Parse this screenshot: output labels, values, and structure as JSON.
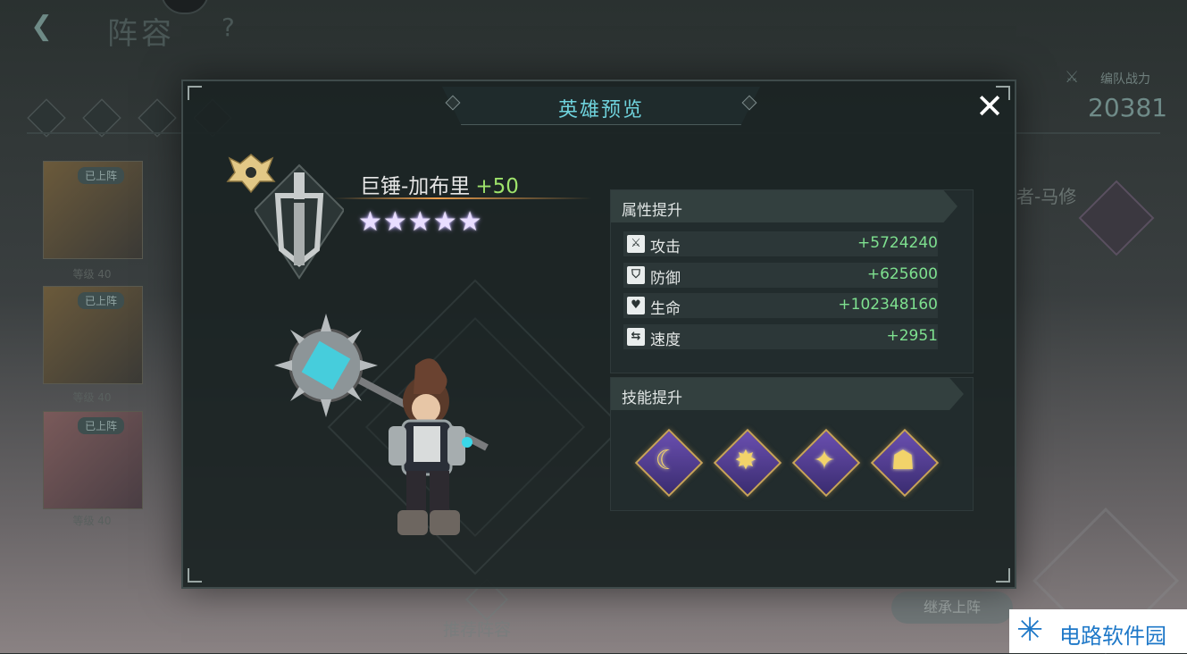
{
  "background": {
    "page_title": "阵容",
    "help": "?",
    "team_power_label": "编队战力",
    "team_power_value": "20381",
    "deployed_badge": "已上阵",
    "level_label": "等级 40",
    "right_hero_name": "者-马修",
    "inherit_button": "继承上阵",
    "recommend_button": "推荐阵容"
  },
  "modal": {
    "title": "英雄预览",
    "close": "✕",
    "hero": {
      "name": "巨锤-加布里",
      "plus": "+50",
      "stars": 5
    },
    "attributes": {
      "header": "属性提升",
      "rows": [
        {
          "icon": "sword-icon",
          "label": "攻击",
          "value": "+5724240"
        },
        {
          "icon": "shield-icon",
          "label": "防御",
          "value": "+625600"
        },
        {
          "icon": "heart-icon",
          "label": "生命",
          "value": "+102348160"
        },
        {
          "icon": "speed-icon",
          "label": "速度",
          "value": "+2951"
        }
      ]
    },
    "skills": {
      "header": "技能提升",
      "items": [
        {
          "icon": "hammer-swing-skill-icon"
        },
        {
          "icon": "charge-skill-icon"
        },
        {
          "icon": "orbit-strike-skill-icon"
        },
        {
          "icon": "team-buff-skill-icon"
        }
      ]
    }
  },
  "watermark": {
    "text": "电路软件园"
  },
  "colors": {
    "title_cyan": "#6fd2dc",
    "bonus_green": "#7ee08f",
    "plus_green": "#9ee36b",
    "skill_gold": "#c9a35a",
    "skill_purple": "#6a4fb0"
  }
}
